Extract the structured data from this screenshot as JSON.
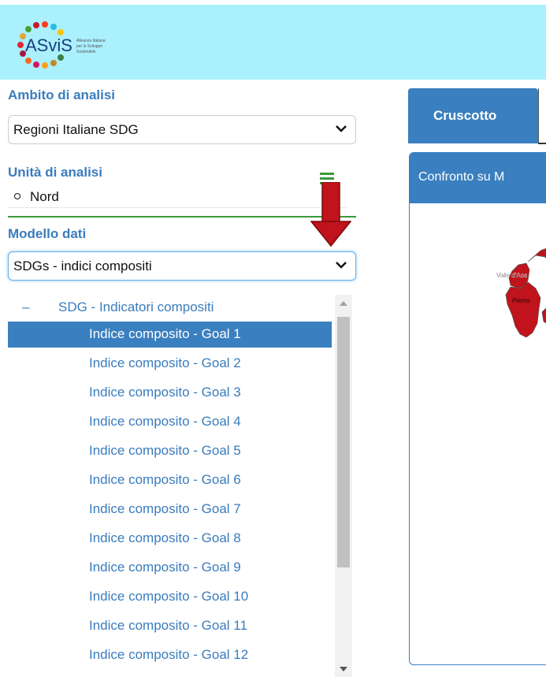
{
  "header": {
    "logo_text": "ASviS",
    "logo_subtitle": "Alleanza Italiana per lo Sviluppo Sostenibile",
    "background_color": "#aaf0fd"
  },
  "sidebar": {
    "ambito": {
      "label": "Ambito di analisi",
      "selected": "Regioni Italiane SDG"
    },
    "unita": {
      "label": "Unità di analisi",
      "items": [
        "Nord"
      ]
    },
    "modello": {
      "label": "Modello dati",
      "selected": "SDGs - indici compositi"
    },
    "tree": {
      "root_toggle": "–",
      "root_label": "SDG - Indicatori compositi",
      "items": [
        "Indice composito - Goal 1",
        "Indice composito - Goal 2",
        "Indice composito - Goal 3",
        "Indice composito - Goal 4",
        "Indice composito - Goal 5",
        "Indice composito - Goal 6",
        "Indice composito - Goal 7",
        "Indice composito - Goal 8",
        "Indice composito - Goal 9",
        "Indice composito - Goal 10",
        "Indice composito - Goal 11",
        "Indice composito - Goal 12"
      ],
      "selected_index": 0
    }
  },
  "main": {
    "tabs": [
      {
        "label": "Cruscotto",
        "active": true
      }
    ],
    "panel": {
      "title": "Confronto su M",
      "map_labels": [
        "Valle d'Aos",
        "Piemo"
      ]
    }
  },
  "colors": {
    "accent": "#3a7fbf",
    "section_text": "#3a7cbd",
    "divider": "#3a9a3a",
    "map_fill": "#c0131b",
    "arrow": "#c0131b"
  }
}
